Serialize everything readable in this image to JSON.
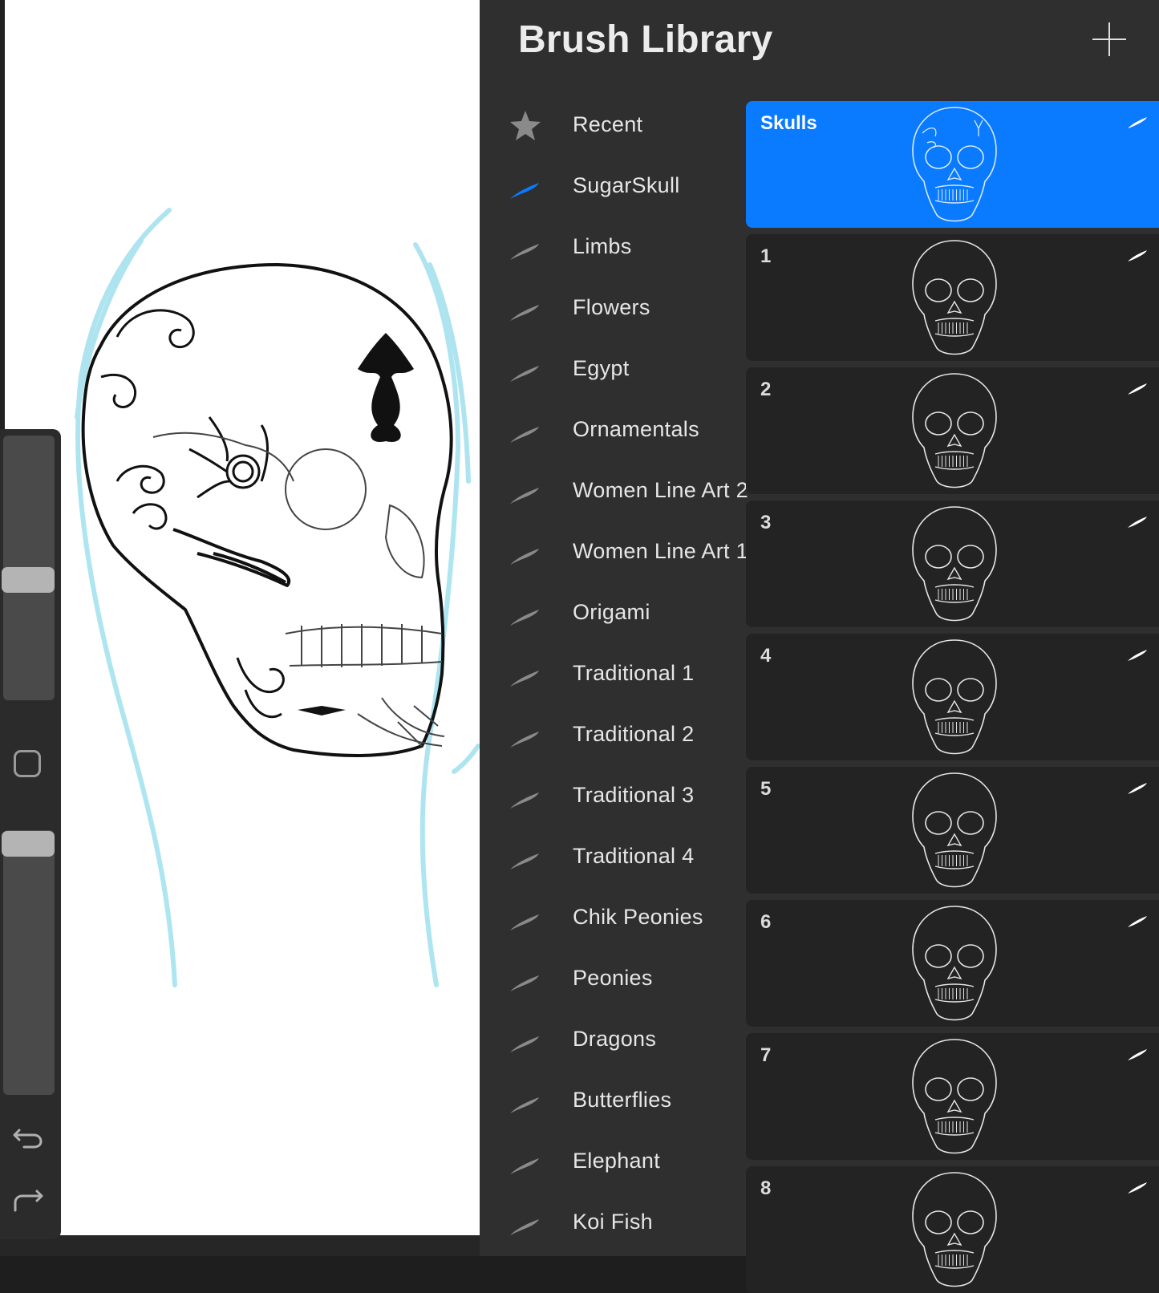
{
  "panel": {
    "title": "Brush Library",
    "add_icon": "plus-icon"
  },
  "brush_sets": [
    {
      "label": "Recent",
      "icon": "star-icon"
    },
    {
      "label": "SugarSkull",
      "icon": "brush-stroke-icon",
      "active": true
    },
    {
      "label": "Limbs",
      "icon": "brush-stroke-icon"
    },
    {
      "label": "Flowers",
      "icon": "brush-stroke-icon"
    },
    {
      "label": "Egypt",
      "icon": "brush-stroke-icon"
    },
    {
      "label": "Ornamentals",
      "icon": "brush-stroke-icon"
    },
    {
      "label": "Women Line Art 2",
      "icon": "brush-stroke-icon"
    },
    {
      "label": "Women Line Art 1",
      "icon": "brush-stroke-icon"
    },
    {
      "label": "Origami",
      "icon": "brush-stroke-icon"
    },
    {
      "label": "Traditional 1",
      "icon": "brush-stroke-icon"
    },
    {
      "label": "Traditional 2",
      "icon": "brush-stroke-icon"
    },
    {
      "label": "Traditional 3",
      "icon": "brush-stroke-icon"
    },
    {
      "label": "Traditional 4",
      "icon": "brush-stroke-icon"
    },
    {
      "label": "Chik Peonies",
      "icon": "brush-stroke-icon"
    },
    {
      "label": "Peonies",
      "icon": "brush-stroke-icon"
    },
    {
      "label": "Dragons",
      "icon": "brush-stroke-icon"
    },
    {
      "label": "Butterflies",
      "icon": "brush-stroke-icon"
    },
    {
      "label": "Elephant",
      "icon": "brush-stroke-icon"
    },
    {
      "label": "Koi Fish",
      "icon": "brush-stroke-icon"
    }
  ],
  "brushes": [
    {
      "name": "Skulls",
      "selected": true
    },
    {
      "name": "1"
    },
    {
      "name": "2"
    },
    {
      "name": "3"
    },
    {
      "name": "4"
    },
    {
      "name": "5"
    },
    {
      "name": "6"
    },
    {
      "name": "7"
    },
    {
      "name": "8"
    }
  ],
  "sidebar": {
    "modify_icon": "square-modify-icon",
    "undo_icon": "undo-arrow-icon",
    "redo_icon": "redo-arrow-icon"
  },
  "colors": {
    "accent": "#0a7aff",
    "panel_bg": "#2f2f2f",
    "sketch_blue": "#8fdcea"
  }
}
